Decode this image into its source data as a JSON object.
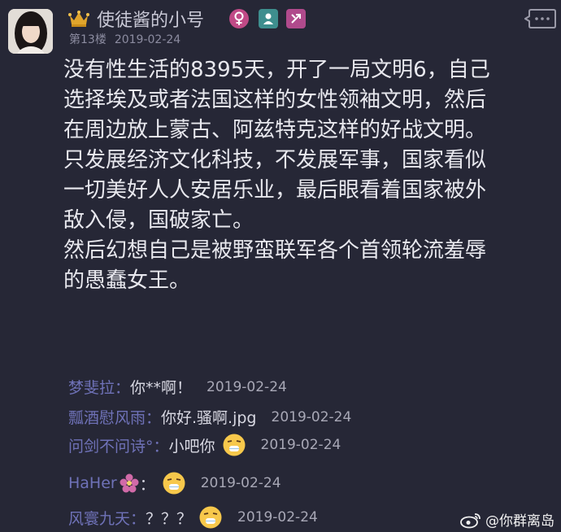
{
  "user": {
    "name": "使徒酱的小号",
    "floor": "第13楼",
    "date": "2019-02-24"
  },
  "post": {
    "lines": [
      "没有性生活的8395天，开了一局文明6，自己",
      "选择埃及或者法国这样的女性领袖文明，然后",
      "在周边放上蒙古、阿兹特克这样的好战文明。",
      "只发展经济文化科技，不发展军事，国家看似",
      "一切美好人人安居乐业，最后眼看着国家被外",
      "敌入侵，国破家亡。",
      "然后幻想自己是被野蛮联军各个首领轮流羞辱",
      "的愚蠢女王。"
    ]
  },
  "comments": [
    {
      "user": "梦斐拉：",
      "text": "你**啊！",
      "date": "2019-02-24",
      "emoji": ""
    },
    {
      "user": "瓢酒慰风雨：",
      "text": "你好.骚啊.jpg",
      "date": "2019-02-24",
      "emoji": ""
    },
    {
      "user": "问剑不问诗°：",
      "text": "小吧你",
      "date": "2019-02-24",
      "emoji": "sick-face"
    },
    {
      "user": "HaHer",
      "text": "：",
      "date": "2019-02-24",
      "emoji": "sick-face"
    },
    {
      "user": "风寰九天：",
      "text": "？？？",
      "date": "2019-02-24",
      "emoji": "sick-face"
    }
  ],
  "watermark": {
    "text": "@你群离岛"
  },
  "colors": {
    "background": "#262736",
    "username": "#6f72b8",
    "text": "#e8e8ee"
  },
  "icons": [
    "avatar",
    "crown-icon",
    "female-icon",
    "user-badge-icon",
    "swap-icon",
    "reply-icon",
    "flower-icon",
    "sick-face-emoji",
    "weibo-logo-icon"
  ]
}
